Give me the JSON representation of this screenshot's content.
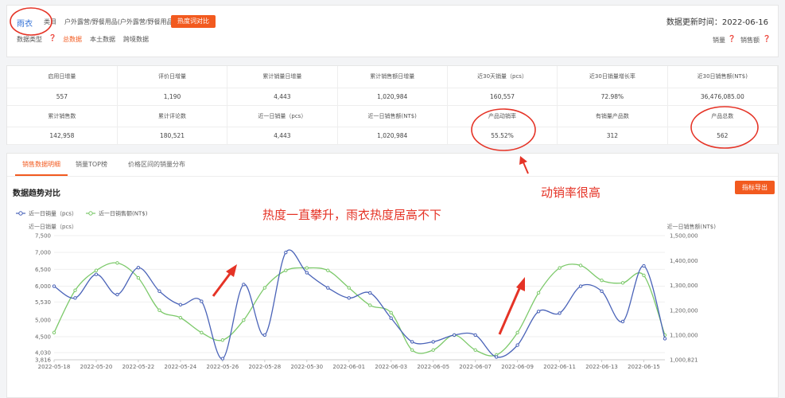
{
  "top": {
    "category_prefix": "类目",
    "category_name": "户外露营/野餐用品(户外露营/野餐用品)",
    "compare_button": "热度词对比",
    "update_label": "数据更新时间：2022-06-16",
    "data_type_label": "数据类型",
    "data_types": [
      "总数据",
      "本土数据",
      "跨境数据"
    ],
    "sort_sales": "销量",
    "sort_revenue": "销售额",
    "keyword": "雨衣"
  },
  "stats": {
    "row1_headers": [
      "启用日增量",
      "评价日增量",
      "累计销量日增量",
      "累计销售额日增量",
      "近30天销量（pcs）",
      "近30日销量增长率",
      "近30日销售额(NT$)"
    ],
    "row1_values": [
      "557",
      "1,190",
      "4,443",
      "1,020,984",
      "160,557",
      "72.98%",
      "36,476,085.00"
    ],
    "row2_headers": [
      "累计销售数",
      "累计评论数",
      "近一日销量（pcs）",
      "近一日销售额(NT$)",
      "产品动销率",
      "有销量产品数",
      "产品总数"
    ],
    "row2_values": [
      "142,958",
      "180,521",
      "4,443",
      "1,020,984",
      "55.52%",
      "312",
      "562"
    ]
  },
  "tabs": [
    "销售数据明细",
    "销量TOP榜",
    "价格区间的销量分布"
  ],
  "export_button": "指标导出",
  "annotations": {
    "sales_rate": "动销率很高",
    "trend": "热度一直攀升，雨衣热度居高不下"
  },
  "chart_data": {
    "type": "line",
    "title": "数据趋势对比",
    "ylabel_left": "近一日销量（pcs）",
    "ylabel_right": "近一日销售额(NT$)",
    "x": [
      "2022-05-18",
      "2022-05-19",
      "2022-05-20",
      "2022-05-21",
      "2022-05-22",
      "2022-05-23",
      "2022-05-24",
      "2022-05-25",
      "2022-05-26",
      "2022-05-27",
      "2022-05-28",
      "2022-05-29",
      "2022-05-30",
      "2022-05-31",
      "2022-06-01",
      "2022-06-02",
      "2022-06-03",
      "2022-06-04",
      "2022-06-05",
      "2022-06-06",
      "2022-06-07",
      "2022-06-08",
      "2022-06-09",
      "2022-06-10",
      "2022-06-11",
      "2022-06-12",
      "2022-06-13",
      "2022-06-14",
      "2022-06-15",
      "2022-06-16"
    ],
    "x_ticks": [
      "2022-05-18",
      "2022-05-20",
      "2022-05-22",
      "2022-05-24",
      "2022-05-26",
      "2022-05-28",
      "2022-05-30",
      "2022-06-01",
      "2022-06-03",
      "2022-06-05",
      "2022-06-07",
      "2022-06-09",
      "2022-06-11",
      "2022-06-13",
      "2022-06-15"
    ],
    "yleft_ticks": [
      "3,816",
      "4,030",
      "4,500",
      "5,000",
      "5,530",
      "6,000",
      "6,500",
      "7,000",
      "7,500"
    ],
    "yright_ticks": [
      "1,000,821",
      "1,100,000",
      "1,200,000",
      "1,300,000",
      "1,400,000",
      "1,500,000"
    ],
    "ylim_left": [
      3816,
      7500
    ],
    "ylim_right": [
      1000821,
      1500000
    ],
    "series": [
      {
        "name": "近一日销量（pcs）",
        "color": "#4a63b8",
        "axis": "left",
        "values": [
          6000,
          5650,
          6350,
          5750,
          6550,
          5850,
          5450,
          5550,
          3850,
          6050,
          4550,
          7000,
          6400,
          5950,
          5650,
          5800,
          5050,
          4350,
          4350,
          4550,
          4550,
          3900,
          4250,
          5250,
          5200,
          6000,
          5850,
          4950,
          6600,
          4443
        ]
      },
      {
        "name": "近一日销售额(NT$)",
        "color": "#7cc96a",
        "axis": "right",
        "values": [
          1110000,
          1280000,
          1360000,
          1390000,
          1330000,
          1200000,
          1170000,
          1110000,
          1080000,
          1160000,
          1290000,
          1360000,
          1370000,
          1360000,
          1290000,
          1220000,
          1190000,
          1040000,
          1040000,
          1100000,
          1040000,
          1020000,
          1110000,
          1270000,
          1370000,
          1380000,
          1320000,
          1310000,
          1340000,
          1100000
        ]
      }
    ]
  }
}
